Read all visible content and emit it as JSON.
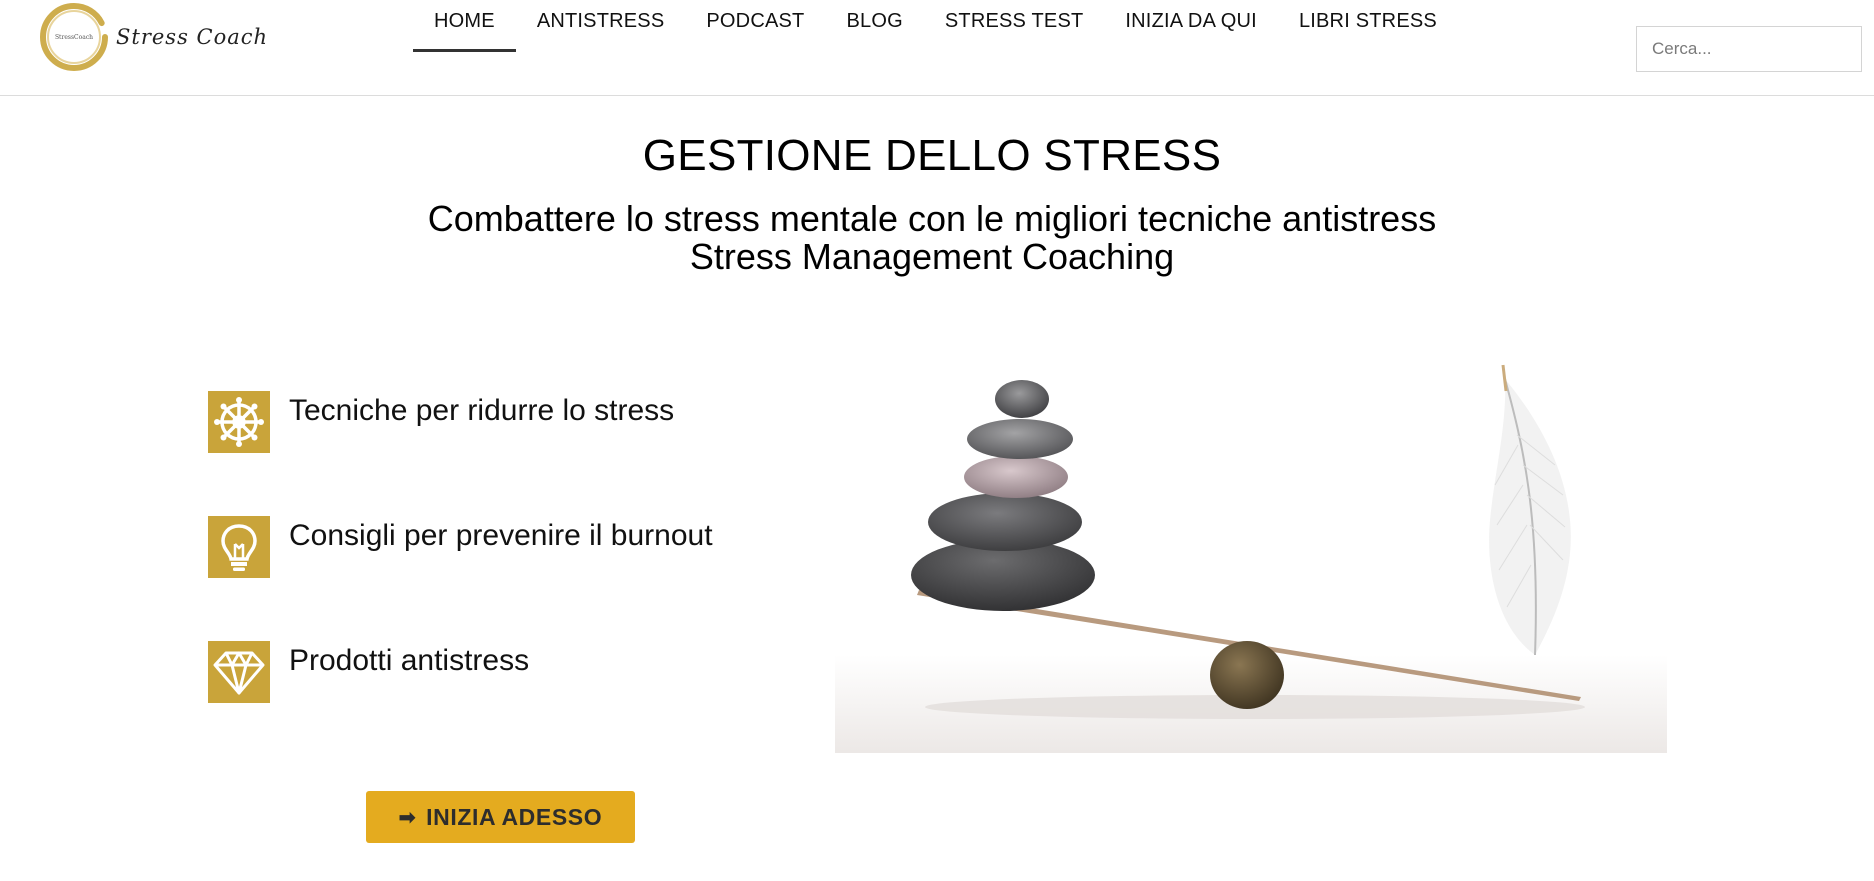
{
  "header": {
    "logo_text": "Stress Coach",
    "logo_badge_text": "StressCoach",
    "nav": [
      {
        "label": "HOME",
        "active": true
      },
      {
        "label": "ANTISTRESS",
        "active": false
      },
      {
        "label": "PODCAST",
        "active": false
      },
      {
        "label": "BLOG",
        "active": false
      },
      {
        "label": "STRESS TEST",
        "active": false
      },
      {
        "label": "INIZIA DA QUI",
        "active": false
      },
      {
        "label": "LIBRI STRESS",
        "active": false
      }
    ],
    "search_placeholder": "Cerca..."
  },
  "hero": {
    "title": "GESTIONE DELLO STRESS",
    "subtitle_line1": "Combattere lo stress mentale con le migliori tecniche antistress",
    "subtitle_line2": "Stress Management Coaching"
  },
  "features": [
    {
      "icon": "dharma-wheel-icon",
      "label": "Tecniche per ridurre lo stress"
    },
    {
      "icon": "lightbulb-icon",
      "label": "Consigli per prevenire il burnout"
    },
    {
      "icon": "diamond-icon",
      "label": "Prodotti antistress"
    }
  ],
  "cta": {
    "label": "INIZIA ADESSO",
    "icon": "arrow-right-icon"
  },
  "colors": {
    "accent": "#c9a43a",
    "button": "#e4ab1f",
    "nav_underline": "#333333"
  }
}
